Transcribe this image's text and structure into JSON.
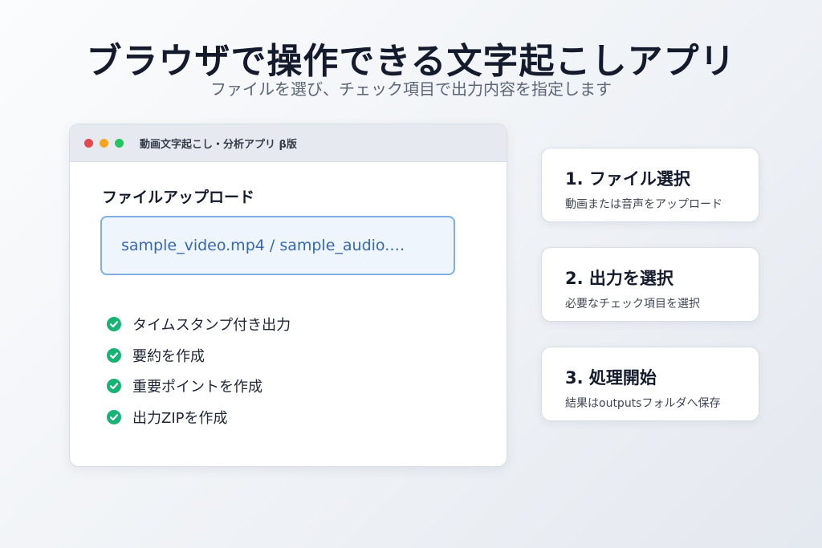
{
  "hero": {
    "title": "ブラウザで操作できる文字起こしアプリ",
    "subtitle": "ファイルを選び、チェック項目で出力内容を指定します"
  },
  "app_window": {
    "title": "動画文字起こし・分析アプリ β版",
    "traffic_lights": [
      "#e5484d",
      "#f5a524",
      "#22c55e"
    ],
    "upload_heading": "ファイルアップロード",
    "upload_value": "sample_video.mp4 / sample_audio.…",
    "features": [
      {
        "label": "タイムスタンプ付き出力",
        "checked": true
      },
      {
        "label": "要約を作成",
        "checked": true
      },
      {
        "label": "重要ポイントを作成",
        "checked": true
      },
      {
        "label": "出力ZIPを作成",
        "checked": true
      }
    ],
    "check_color": "#16b374"
  },
  "steps": [
    {
      "title": "1. ファイル選択",
      "description": "動画または音声をアップロード"
    },
    {
      "title": "2. 出力を選択",
      "description": "必要なチェック項目を選択"
    },
    {
      "title": "3. 処理開始",
      "description": "結果はoutputsフォルダへ保存"
    }
  ],
  "colors": {
    "accent_blue": "#3567b3",
    "upload_border": "#7eaee4",
    "upload_bg": "#eef5fd",
    "titlebar_bg": "#e6eaf0"
  }
}
